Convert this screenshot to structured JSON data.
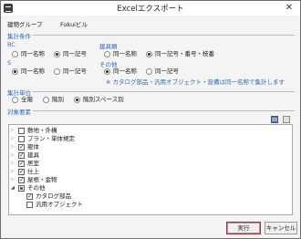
{
  "window": {
    "title": "Excelエクスポート",
    "close_glyph": "✕"
  },
  "header": {
    "group": "建物グループ",
    "building": "Fukuiビル"
  },
  "conditions": {
    "heading": "集計条件",
    "rc": {
      "label": "RC",
      "options": [
        "同一名称",
        "同一記号"
      ],
      "selected": 1
    },
    "fittings": {
      "label": "建具類",
      "options": [
        "同一名称",
        "同一記号・番号・枝番"
      ],
      "selected": 1
    },
    "s": {
      "label": "S",
      "options": [
        "同一名称",
        "同一記号"
      ],
      "selected": 0
    },
    "other": {
      "label": "その他",
      "options": [
        "同一名称",
        "同一記号"
      ],
      "selected": 0,
      "note": "※ カタログ部品・汎用オブジェクト・設備は同一名称で集計します"
    }
  },
  "unit": {
    "heading": "集計単位",
    "options": [
      "全階",
      "階別",
      "階別スペース別"
    ],
    "selected": 2
  },
  "targets": {
    "heading": "対象要素",
    "items": [
      {
        "label": "敷地・外構",
        "checked": false
      },
      {
        "label": "プラン・単体規定",
        "checked": false
      },
      {
        "label": "躯体",
        "checked": true
      },
      {
        "label": "建具",
        "checked": true
      },
      {
        "label": "居室",
        "checked": true
      },
      {
        "label": "仕上",
        "checked": true
      },
      {
        "label": "屋根・金物",
        "checked": true
      },
      {
        "label": "その他",
        "checked": "partial"
      },
      {
        "label": "カタログ部品",
        "checked": true
      },
      {
        "label": "汎用オブジェクト",
        "checked": false
      }
    ]
  },
  "buttons": {
    "run": "実行",
    "cancel": "キャンセル"
  },
  "colors": {
    "section": "#2e69b4",
    "primary_border": "#c4262e"
  }
}
